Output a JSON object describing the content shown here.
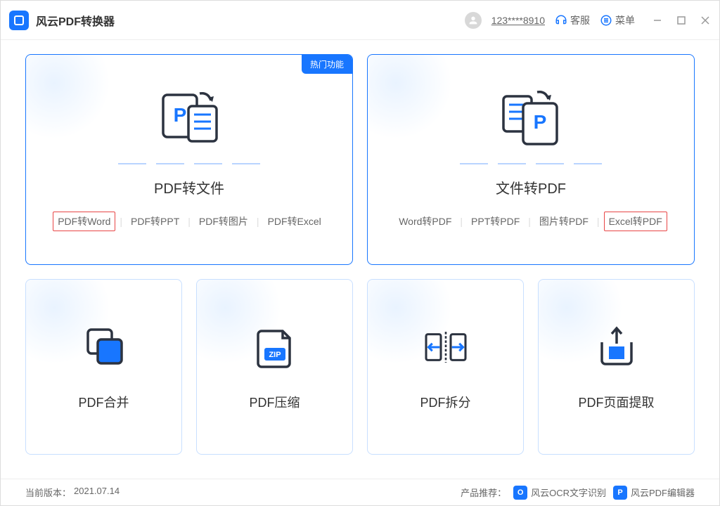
{
  "app": {
    "title": "风云PDF转换器"
  },
  "header": {
    "username": "123****8910",
    "support": "客服",
    "menu": "菜单"
  },
  "cards": {
    "pdf_to_file": {
      "badge": "热门功能",
      "title": "PDF转文件",
      "items": [
        "PDF转Word",
        "PDF转PPT",
        "PDF转图片",
        "PDF转Excel"
      ],
      "highlight_index": 0
    },
    "file_to_pdf": {
      "title": "文件转PDF",
      "items": [
        "Word转PDF",
        "PPT转PDF",
        "图片转PDF",
        "Excel转PDF"
      ],
      "highlight_index": 3
    },
    "merge": {
      "title": "PDF合并"
    },
    "compress": {
      "title": "PDF压缩"
    },
    "split": {
      "title": "PDF拆分"
    },
    "extract": {
      "title": "PDF页面提取"
    }
  },
  "footer": {
    "version_label": "当前版本：",
    "version": "2021.07.14",
    "recommend_label": "产品推荐：",
    "products": [
      "风云OCR文字识别",
      "风云PDF编辑器"
    ]
  }
}
